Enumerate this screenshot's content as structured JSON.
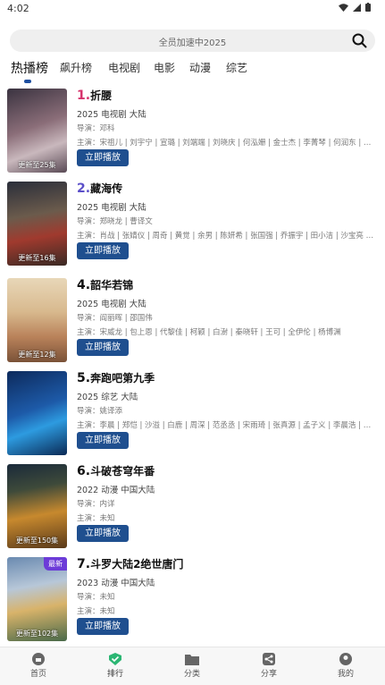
{
  "status_bar": {
    "time": "4:02"
  },
  "search": {
    "placeholder": "全员加速中2025"
  },
  "tabs": [
    {
      "label": "热播榜"
    },
    {
      "label": "飙升榜"
    },
    {
      "label": "电视剧"
    },
    {
      "label": "电影"
    },
    {
      "label": "动漫"
    },
    {
      "label": "综艺"
    }
  ],
  "items": [
    {
      "rank": "1.",
      "name": "折腰",
      "rank_color": "#d6336c",
      "meta": "2025  电视剧  大陆",
      "director": "导演：邓科",
      "cast": "主演：宋祖儿 | 刘宇宁 | 宣璐 | 刘端端 | 刘晓庆 | 何泓姗 | 金士杰 | 李菁琴 | 何润东 | 王...",
      "episode": "更新至25集",
      "badge": "",
      "play": "立即播放"
    },
    {
      "rank": "2.",
      "name": "藏海传",
      "rank_color": "#5b4fc9",
      "meta": "2025  电视剧  大陆",
      "director": "导演：郑晓龙 | 曹译文",
      "cast": "主演：肖战 | 张婧仪 | 周奇 | 黄觉 | 余男 | 陈妍希 | 张国强 | 乔振宇 | 田小洁 | 沙宝亮 | 张...",
      "episode": "更新至16集",
      "badge": "",
      "play": "立即播放"
    },
    {
      "rank": "4.",
      "name": "韶华若锦",
      "rank_color": "#111111",
      "meta": "2025  电视剧  大陆",
      "director": "导演：阎丽晖 | 邵国伟",
      "cast": "主演：宋威龙 | 包上恩 | 代黎佳 | 柯颖 | 白澍 | 秦晓轩 | 王可 | 全伊伦 | 杨博渊",
      "episode": "更新至12集",
      "badge": "",
      "play": "立即播放"
    },
    {
      "rank": "5.",
      "name": "奔跑吧第九季",
      "rank_color": "#111111",
      "meta": "2025  综艺  大陆",
      "director": "导演：姚译添",
      "cast": "主演：李晨 | 郑恺 | 沙溢 | 白鹿 | 周深 | 范丞丞 | 宋雨琦 | 张真源 | 孟子义 | 李晨浩 | 敖瑞...",
      "episode": "",
      "badge": "",
      "play": "立即播放"
    },
    {
      "rank": "6.",
      "name": "斗破苍穹年番",
      "rank_color": "#111111",
      "meta": "2022  动漫  中国大陆",
      "director": "导演：内详",
      "cast": "主演：未知",
      "episode": "更新至150集",
      "badge": "",
      "play": "立即播放"
    },
    {
      "rank": "7.",
      "name": "斗罗大陆2绝世唐门",
      "rank_color": "#111111",
      "meta": "2023  动漫  中国大陆",
      "director": "导演：未知",
      "cast": "主演：未知",
      "episode": "更新至102集",
      "badge": "最新",
      "play": "立即播放"
    }
  ],
  "bottom_nav": [
    {
      "label": "首页",
      "icon": "home-icon"
    },
    {
      "label": "排行",
      "icon": "ranking-icon"
    },
    {
      "label": "分类",
      "icon": "folder-icon"
    },
    {
      "label": "分享",
      "icon": "share-icon"
    },
    {
      "label": "我的",
      "icon": "profile-icon"
    }
  ],
  "colors": {
    "accent": "#1f4f8f",
    "active_nav": "#2bb673"
  }
}
